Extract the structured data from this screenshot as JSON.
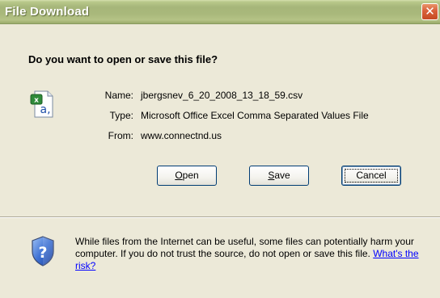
{
  "window": {
    "title": "File Download",
    "close_label": "✕"
  },
  "prompt": {
    "question": "Do you want to open or save this file?"
  },
  "file": {
    "icon": "excel-csv-file-icon",
    "name_label": "Name:",
    "name_value": "jbergsnev_6_20_2008_13_18_59.csv",
    "type_label": "Type:",
    "type_value": "Microsoft Office Excel Comma Separated Values File",
    "from_label": "From:",
    "from_value": "www.connectnd.us"
  },
  "buttons": {
    "open_mnemonic": "O",
    "open_rest": "pen",
    "save_mnemonic": "S",
    "save_rest": "ave",
    "cancel_label": "Cancel"
  },
  "warning": {
    "icon": "security-shield-question-icon",
    "text": "While files from the Internet can be useful, some files can potentially harm your computer. If you do not trust the source, do not open or save this file. ",
    "link_text": "What's the risk?"
  },
  "colors": {
    "titlebar": "#a9b87b",
    "close_button": "#d9603a",
    "dialog_bg": "#ece9d8",
    "link": "#0000ff"
  }
}
